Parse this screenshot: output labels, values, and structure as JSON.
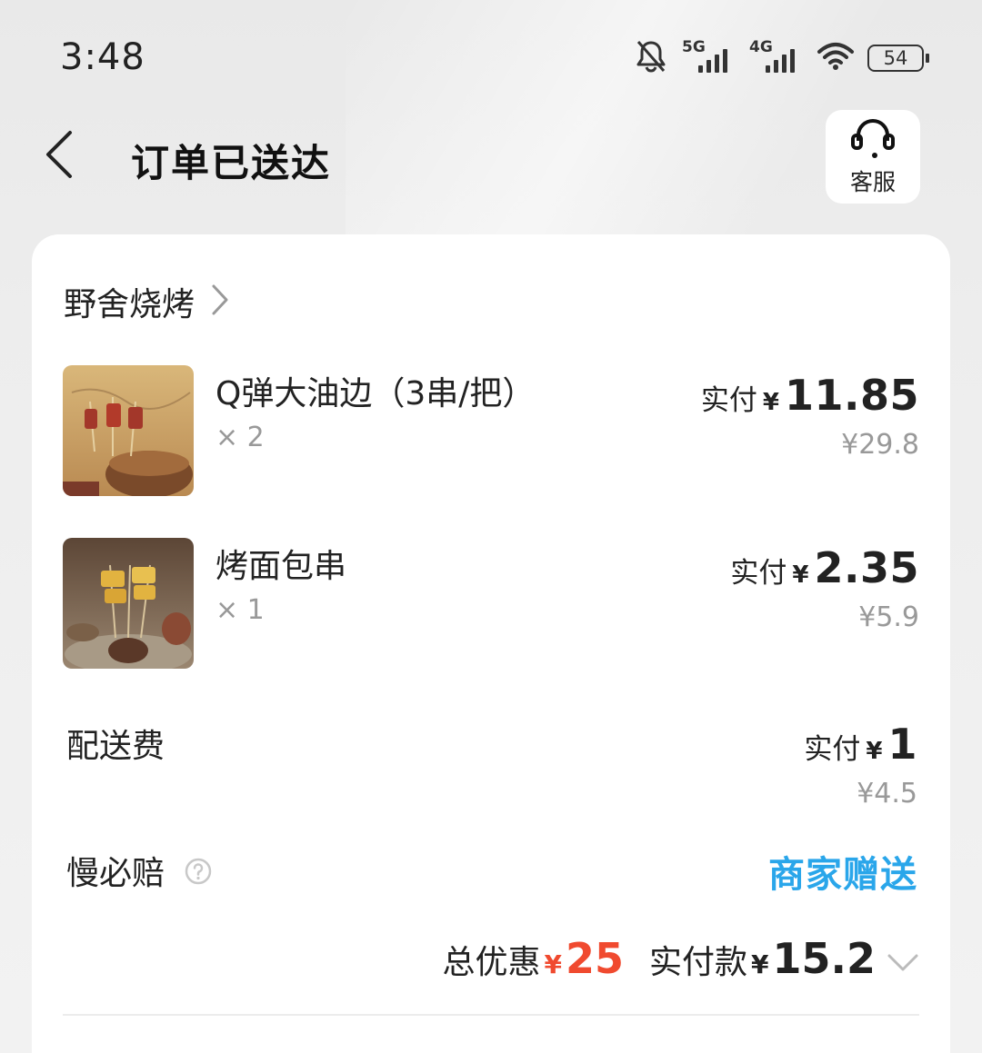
{
  "status_bar": {
    "time": "3:48",
    "net1": "5G",
    "net2": "4G",
    "battery": "54",
    "icons": [
      "mute-bell-icon",
      "signal-5g-icon",
      "signal-4g-icon",
      "wifi-icon",
      "battery-icon"
    ]
  },
  "header": {
    "title": "订单已送达",
    "back_icon": "chevron-left-icon",
    "service_label": "客服",
    "service_icon": "headset-icon"
  },
  "order": {
    "shop_name": "野舍烧烤",
    "items": [
      {
        "name": "Q弹大油边（3串/把）",
        "qty": "× 2",
        "paid_label": "实付",
        "currency": "¥",
        "paid": "11.85",
        "original": "¥29.8"
      },
      {
        "name": "烤面包串",
        "qty": "× 1",
        "paid_label": "实付",
        "currency": "¥",
        "paid": "2.35",
        "original": "¥5.9"
      }
    ],
    "delivery": {
      "label": "配送费",
      "paid_label": "实付",
      "currency": "¥",
      "paid": "1",
      "original": "¥4.5"
    },
    "guarantee": {
      "label": "慢必赔",
      "value": "商家赠送"
    },
    "summary": {
      "discount_label": "总优惠",
      "discount_currency": "¥",
      "discount": "25",
      "total_label": "实付款",
      "total_currency": "¥",
      "total": "15.2"
    }
  },
  "colors": {
    "accent_red": "#f04a2f",
    "accent_blue": "#2aa6ea"
  }
}
